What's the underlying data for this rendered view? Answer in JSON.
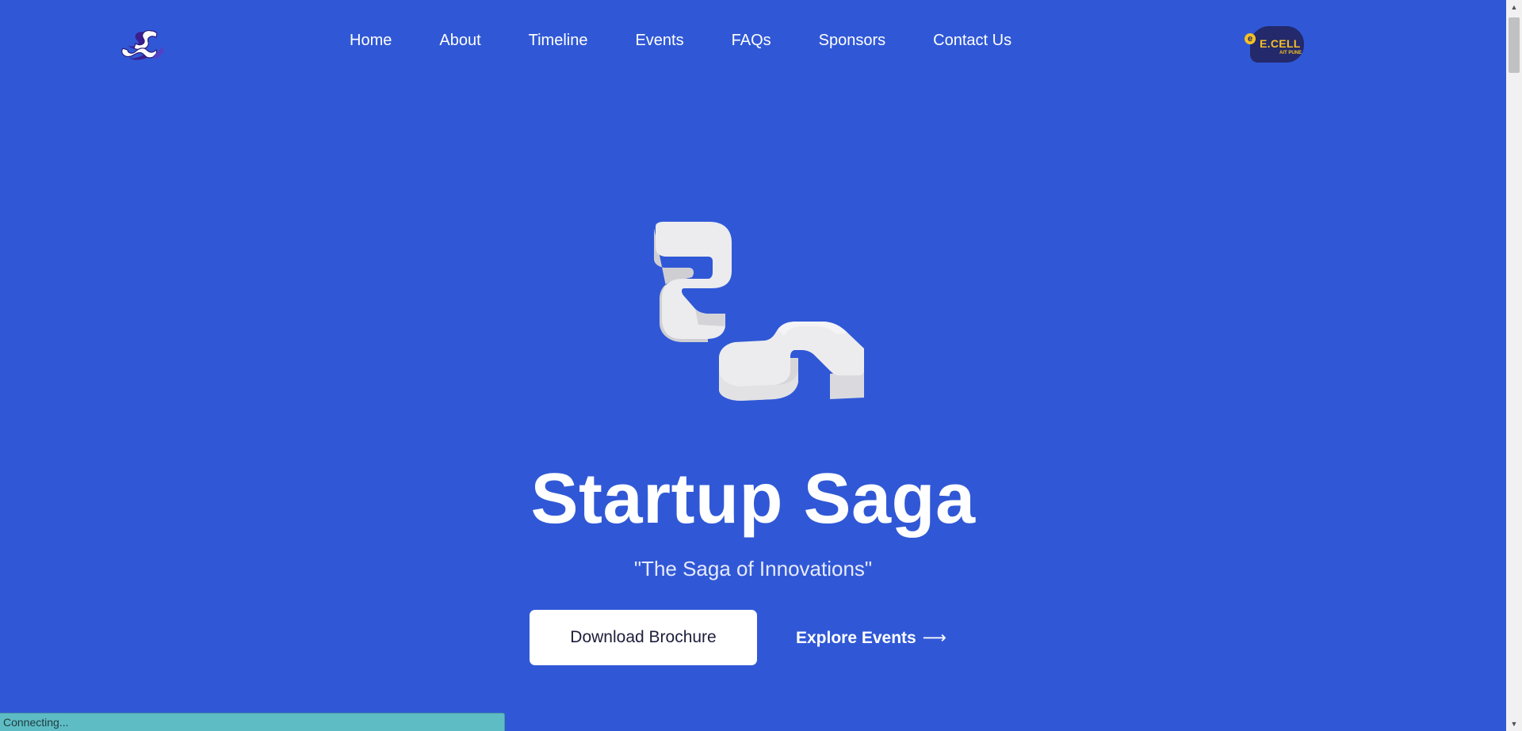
{
  "header": {
    "logo_icon": "startup-saga-logo-icon",
    "nav": [
      {
        "label": "Home"
      },
      {
        "label": "About"
      },
      {
        "label": "Timeline"
      },
      {
        "label": "Events"
      },
      {
        "label": "FAQs"
      },
      {
        "label": "Sponsors"
      },
      {
        "label": "Contact Us"
      }
    ],
    "partner_logo": {
      "name": "E.CELL",
      "subtitle": "AIT PUNE",
      "bulb_letter": "e",
      "icon": "ecell-logo-icon"
    }
  },
  "hero": {
    "emblem_icon": "3d-s-emblem-icon",
    "title": "Startup Saga",
    "tagline": "\"The Saga of Innovations\"",
    "primary_button": "Download Brochure",
    "secondary_link": "Explore Events",
    "secondary_arrow": "⟶"
  },
  "status_bar": {
    "text": "Connecting..."
  },
  "scrollbar": {
    "up_arrow": "▲",
    "down_arrow": "▼"
  },
  "colors": {
    "background": "#3058d6",
    "text": "#ffffff",
    "button_bg": "#ffffff",
    "button_text": "#1b1f3a",
    "status_bar_bg": "#5ebcc4",
    "partner_badge": "#23296b",
    "partner_accent": "#f4c024"
  }
}
